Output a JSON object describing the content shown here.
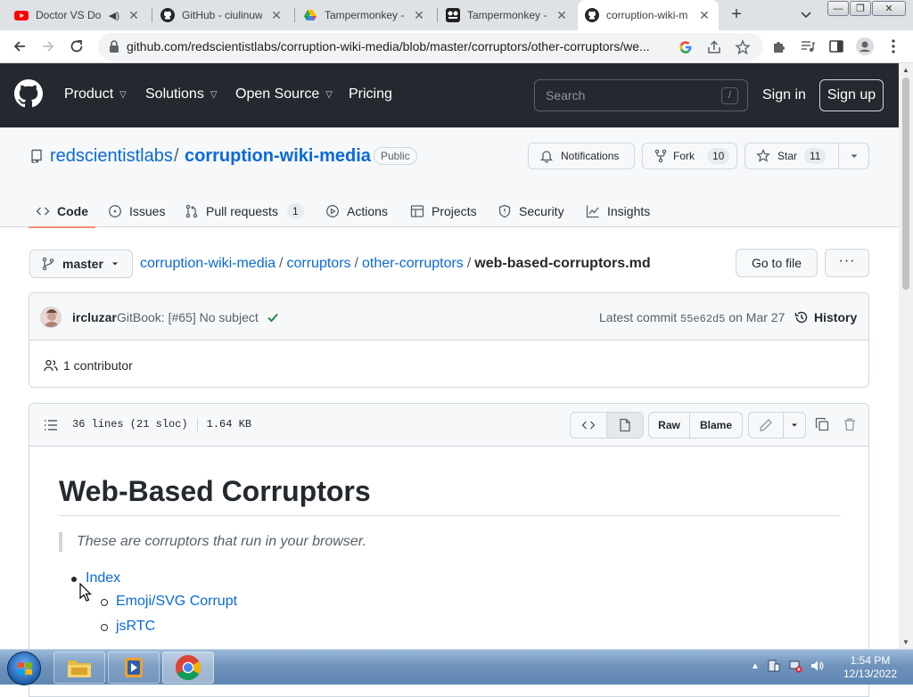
{
  "browser": {
    "tabs": [
      {
        "title": "Doctor VS Do",
        "icon": "youtube-icon",
        "active": false
      },
      {
        "title": "GitHub - ciulinuw",
        "icon": "github-icon",
        "active": false
      },
      {
        "title": "Tampermonkey - ",
        "icon": "google-drive-icon",
        "active": false
      },
      {
        "title": "Tampermonkey - ",
        "icon": "tampermonkey-icon",
        "active": false
      },
      {
        "title": "corruption-wiki-m",
        "icon": "github-icon",
        "active": true
      }
    ],
    "url": "github.com/redscientistlabs/corruption-wiki-media/blob/master/corruptors/other-corruptors/we..."
  },
  "gh_header": {
    "nav": [
      "Product",
      "Solutions",
      "Open Source",
      "Pricing"
    ],
    "search_placeholder": "Search",
    "search_key": "/",
    "sign_in": "Sign in",
    "sign_up": "Sign up"
  },
  "repo": {
    "owner": "redscientistlabs",
    "slash": "/",
    "name": "corruption-wiki-media",
    "visibility": "Public",
    "notifications_label": "Notifications",
    "fork_label": "Fork",
    "fork_count": "10",
    "star_label": "Star",
    "star_count": "11",
    "tabs": [
      {
        "label": "Code",
        "icon": "code-icon",
        "count": null,
        "selected": true
      },
      {
        "label": "Issues",
        "icon": "issue-icon",
        "count": null,
        "selected": false
      },
      {
        "label": "Pull requests",
        "icon": "pull-request-icon",
        "count": "1",
        "selected": false
      },
      {
        "label": "Actions",
        "icon": "play-icon",
        "count": null,
        "selected": false
      },
      {
        "label": "Projects",
        "icon": "table-icon",
        "count": null,
        "selected": false
      },
      {
        "label": "Security",
        "icon": "shield-icon",
        "count": null,
        "selected": false
      },
      {
        "label": "Insights",
        "icon": "graph-icon",
        "count": null,
        "selected": false
      }
    ]
  },
  "breadcrumb": {
    "branch": "master",
    "parts": [
      "corruption-wiki-media",
      "corruptors",
      "other-corruptors"
    ],
    "separator": "/",
    "file": "web-based-corruptors.md",
    "go_to_file": "Go to file",
    "more": "···"
  },
  "commit": {
    "author": "ircluzar",
    "message": "GitBook: [#65] No subject",
    "latest_label": "Latest commit",
    "sha": "55e62d5",
    "date": "on Mar 27",
    "history": "History",
    "contributors": "1 contributor"
  },
  "file": {
    "lines": "36 lines (21 sloc)",
    "size": "1.64 KB",
    "raw": "Raw",
    "blame": "Blame"
  },
  "markdown": {
    "h1": "Web-Based Corruptors",
    "quote": "These are corruptors that run in your browser.",
    "list": [
      {
        "label": "Index",
        "children": [
          "Emoji/SVG Corrupt",
          "jsRTC"
        ]
      }
    ]
  },
  "taskbar": {
    "time": "1:54 PM",
    "date": "12/13/2022"
  },
  "colors": {
    "gh_header": "#24292f",
    "link": "#0969da",
    "tab_underline": "#fd8c73",
    "check": "#1a7f37"
  }
}
